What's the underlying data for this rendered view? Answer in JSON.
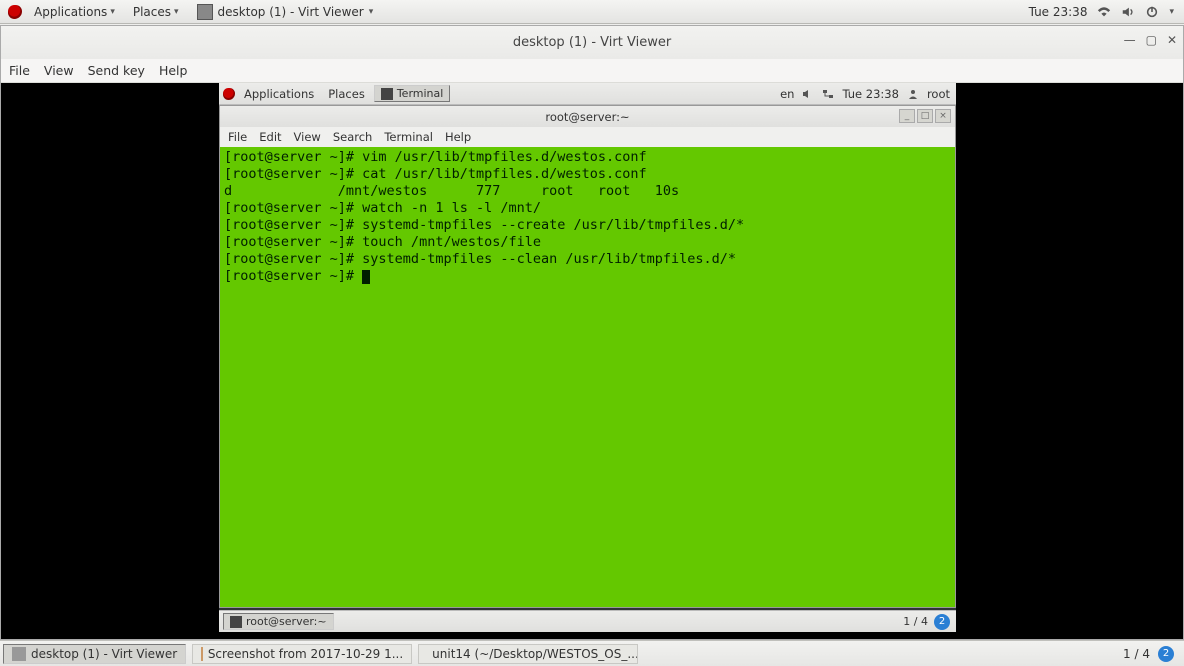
{
  "outer_topbar": {
    "applications": "Applications",
    "places": "Places",
    "task_title": "desktop (1) - Virt Viewer",
    "clock": "Tue 23:38"
  },
  "virt_viewer": {
    "title": "desktop (1) - Virt Viewer",
    "menus": {
      "file": "File",
      "view": "View",
      "sendkey": "Send key",
      "help": "Help"
    }
  },
  "inner_topbar": {
    "applications": "Applications",
    "places": "Places",
    "task": "Terminal",
    "lang": "en",
    "clock": "Tue 23:38",
    "user": "root"
  },
  "terminal": {
    "title": "root@server:~",
    "menus": {
      "file": "File",
      "edit": "Edit",
      "view": "View",
      "search": "Search",
      "terminal": "Terminal",
      "help": "Help"
    },
    "lines": [
      "[root@server ~]# vim /usr/lib/tmpfiles.d/westos.conf",
      "[root@server ~]# cat /usr/lib/tmpfiles.d/westos.conf",
      "d             /mnt/westos      777     root   root   10s",
      "[root@server ~]# watch -n 1 ls -l /mnt/",
      "[root@server ~]# systemd-tmpfiles --create /usr/lib/tmpfiles.d/*",
      "[root@server ~]# touch /mnt/westos/file",
      "[root@server ~]# systemd-tmpfiles --clean /usr/lib/tmpfiles.d/*",
      "[root@server ~]# "
    ]
  },
  "inner_bottombar": {
    "task": "root@server:~",
    "workspace": "1 / 4",
    "badge": "2"
  },
  "outer_bottombar": {
    "tasks": [
      "desktop (1) - Virt Viewer",
      "Screenshot from 2017-10-29 1...",
      "unit14 (~/Desktop/WESTOS_OS_..."
    ],
    "workspace": "1 / 4",
    "badge": "2"
  }
}
